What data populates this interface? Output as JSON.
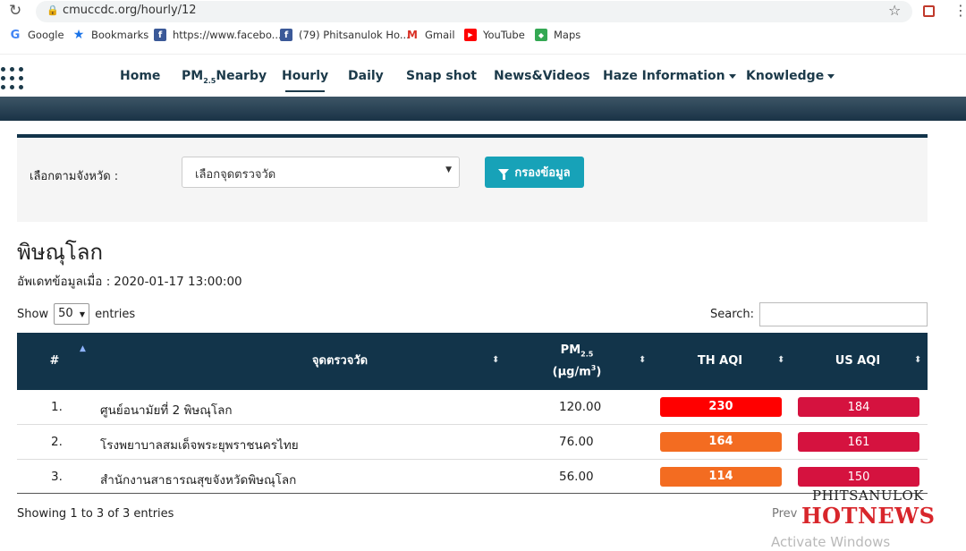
{
  "browser": {
    "url": "cmuccdc.org/hourly/12",
    "bookmarks": [
      {
        "label": "Google",
        "icon": "google-icon",
        "color": "#4285f4"
      },
      {
        "label": "Bookmarks",
        "icon": "star-icon",
        "color": "#1a73e8"
      },
      {
        "label": "https://www.facebo...",
        "icon": "facebook-icon",
        "color": "#3b5998"
      },
      {
        "label": "(79) Phitsanulok Ho...",
        "icon": "facebook-icon",
        "color": "#3b5998"
      },
      {
        "label": "Gmail",
        "icon": "gmail-icon",
        "color": "#d93025"
      },
      {
        "label": "YouTube",
        "icon": "youtube-icon",
        "color": "#ff0000"
      },
      {
        "label": "Maps",
        "icon": "maps-icon",
        "color": "#34a853"
      }
    ]
  },
  "nav": {
    "home": "Home",
    "pm_prefix": "PM",
    "pm_sub": "2.5",
    "pm_suffix": "Nearby",
    "hourly": "Hourly",
    "daily": "Daily",
    "snapshot": "Snap shot",
    "news": "News&Videos",
    "haze": "Haze Information",
    "knowledge": "Knowledge",
    "active": "Hourly"
  },
  "filter": {
    "label": "เลือกตามจังหวัด :",
    "select_value": "เลือกจุดตรวจวัด",
    "button": "กรองข้อมูล"
  },
  "page": {
    "province": "พิษณุโลก",
    "updated_label": "อัพเดทข้อมูลเมื่อ :",
    "updated_value": "2020-01-17 13:00:00"
  },
  "table_controls": {
    "show": "Show",
    "entries_value": "50",
    "entries": "entries",
    "search": "Search:"
  },
  "table": {
    "headers": {
      "num": "#",
      "station": "จุดตรวจวัด",
      "pm_prefix": "PM",
      "pm_sub": "2.5",
      "pm_unit_pre": "(µg/m",
      "pm_unit_sup": "3",
      "pm_unit_post": ")",
      "th_aqi": "TH AQI",
      "us_aqi": "US AQI"
    },
    "rows": [
      {
        "num": "1.",
        "name": "ศูนย์อนามัยที่ 2 พิษณุโลก",
        "pm": "120.00",
        "th_aqi": "230",
        "th_color": "#ff0000",
        "us_aqi": "184",
        "us_color": "#d5123f"
      },
      {
        "num": "2.",
        "name": "โรงพยาบาลสมเด็จพระยุพราชนครไทย",
        "pm": "76.00",
        "th_aqi": "164",
        "th_color": "#f36c21",
        "us_aqi": "161",
        "us_color": "#d5123f"
      },
      {
        "num": "3.",
        "name": "สำนักงานสาธารณสุขจังหวัดพิษณุโลก",
        "pm": "56.00",
        "th_aqi": "114",
        "th_color": "#f36c21",
        "us_aqi": "150",
        "us_color": "#d5123f"
      }
    ]
  },
  "footer": {
    "showing": "Showing 1 to 3 of 3 entries",
    "prev": "Prev"
  },
  "watermark": {
    "line1": "PHITSANULOK",
    "line2": "HOTNEWS",
    "activate": "Activate Windows"
  }
}
